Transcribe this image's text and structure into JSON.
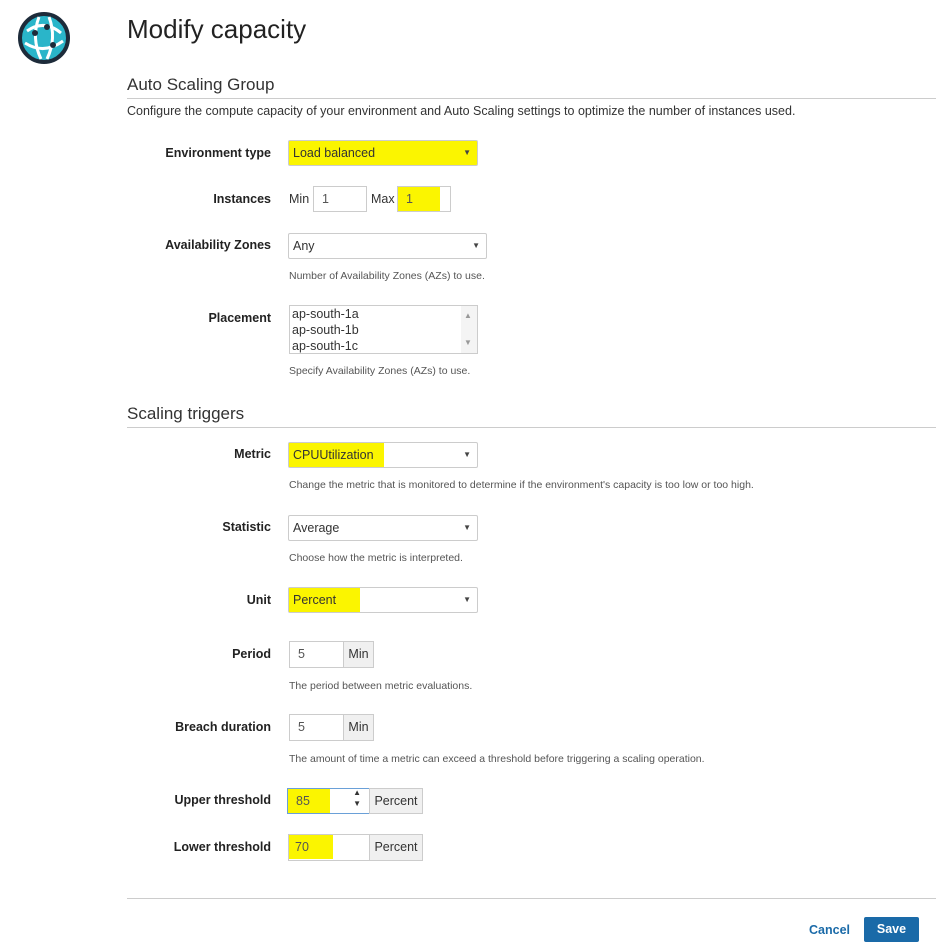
{
  "header": {
    "title": "Modify capacity",
    "logo_icon": "globe-network-icon"
  },
  "auto_scaling": {
    "section_title": "Auto Scaling Group",
    "description": "Configure the compute capacity of your environment and Auto Scaling settings to optimize the number of instances used.",
    "environment_type": {
      "label": "Environment type",
      "value": "Load balanced"
    },
    "instances": {
      "label": "Instances",
      "min_label": "Min",
      "min_value": "1",
      "max_label": "Max",
      "max_value": "1"
    },
    "availability_zones": {
      "label": "Availability Zones",
      "value": "Any",
      "help": "Number of Availability Zones (AZs) to use."
    },
    "placement": {
      "label": "Placement",
      "options": [
        "ap-south-1a",
        "ap-south-1b",
        "ap-south-1c"
      ],
      "help": "Specify Availability Zones (AZs) to use."
    }
  },
  "scaling_triggers": {
    "section_title": "Scaling triggers",
    "metric": {
      "label": "Metric",
      "value": "CPUUtilization",
      "help": "Change the metric that is monitored to determine if the environment's capacity is too low or too high."
    },
    "statistic": {
      "label": "Statistic",
      "value": "Average",
      "help": "Choose how the metric is interpreted."
    },
    "unit": {
      "label": "Unit",
      "value": "Percent"
    },
    "period": {
      "label": "Period",
      "value": "5",
      "unit": "Min",
      "help": "The period between metric evaluations."
    },
    "breach_duration": {
      "label": "Breach duration",
      "value": "5",
      "unit": "Min",
      "help": "The amount of time a metric can exceed a threshold before triggering a scaling operation."
    },
    "upper_threshold": {
      "label": "Upper threshold",
      "value": "85",
      "unit": "Percent"
    },
    "lower_threshold": {
      "label": "Lower threshold",
      "value": "70",
      "unit": "Percent"
    }
  },
  "footer": {
    "cancel_label": "Cancel",
    "save_label": "Save"
  },
  "colors": {
    "highlight": "#fbf500",
    "primary": "#1a6aa8",
    "logo": "#2ab5c9"
  }
}
